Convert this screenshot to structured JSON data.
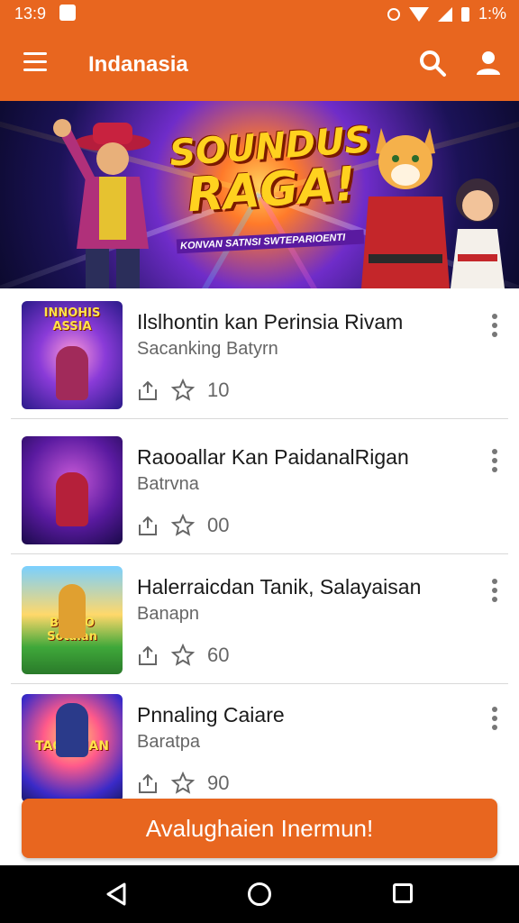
{
  "status_bar": {
    "time": "13:9",
    "battery": "1:%"
  },
  "app_bar": {
    "title": "Indanasia"
  },
  "banner": {
    "title_line1": "SOUNDUS",
    "title_line2": "RAGA!",
    "subtitle": "KONVAN SATNSI SWTEPARIOENTI"
  },
  "items": [
    {
      "title": "Ilslhontin  kan Perinsia Rivam",
      "subtitle": "Sacanking Batyrn",
      "count": "10",
      "thumb_caption": "INNOHIS ASSIA"
    },
    {
      "title": "Raooallar Kan PaidanalRigan",
      "subtitle": "Batrvna",
      "count": "00",
      "thumb_caption": ""
    },
    {
      "title": "Halerraicdan Tanik, Salayaisan",
      "subtitle": "Banapn",
      "count": "60",
      "thumb_caption": "BIOMO Sotalan"
    },
    {
      "title": "Pnnaling Caiare",
      "subtitle": "Baratpa",
      "count": "90",
      "thumb_caption": "TAQUDIAN"
    }
  ],
  "cta": {
    "label": "Avalughaien Inermun!"
  },
  "colors": {
    "accent": "#e8661f",
    "text": "#1a1a1a",
    "muted": "#666666"
  }
}
